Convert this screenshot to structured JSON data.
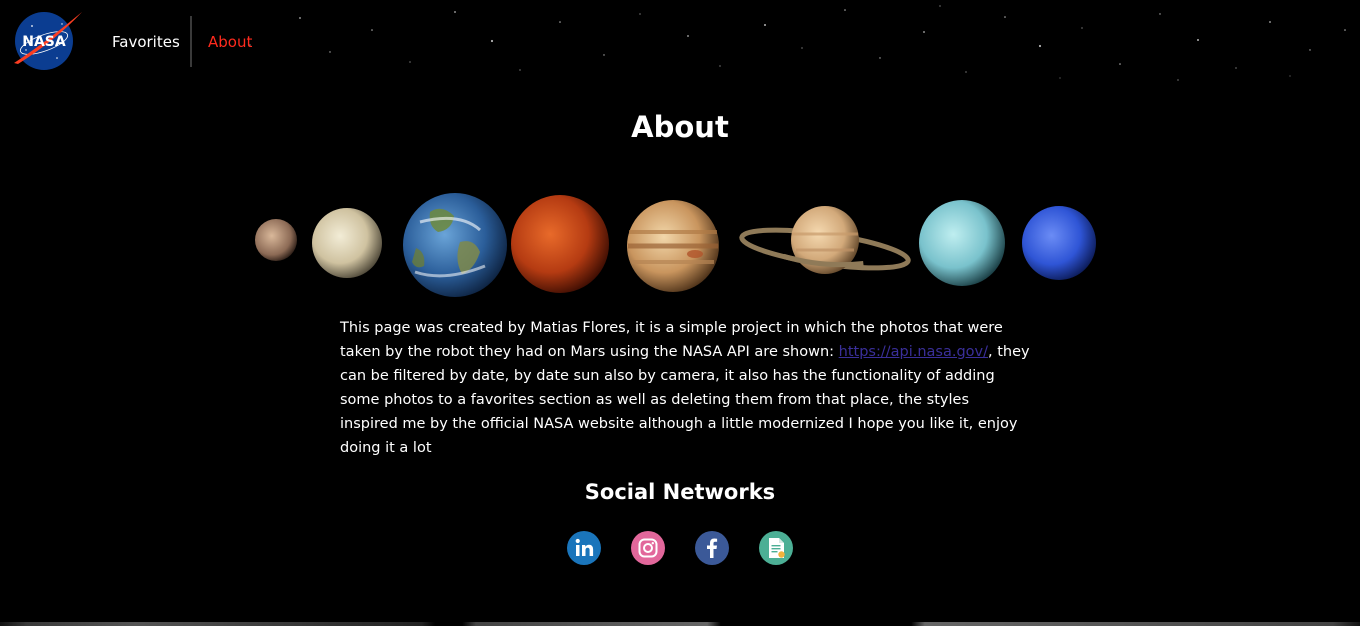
{
  "header": {
    "logo_text": "NASA",
    "nav": {
      "favorites": "Favorites",
      "about": "About"
    },
    "active_color": "#ff2a1d"
  },
  "main": {
    "title": "About",
    "planets": [
      "Mercury",
      "Venus",
      "Earth",
      "Mars",
      "Jupiter",
      "Saturn",
      "Uranus",
      "Neptune"
    ],
    "description": {
      "before_link": "This page was created by Matias Flores, it is a simple project in which the photos that were taken by the robot they had on Mars using the NASA API are shown: ",
      "link_text": "https://api.nasa.gov/",
      "after_link": ", they can be filtered by date, by date sun also by camera, it also has the functionality of adding some photos to a favorites section as well as deleting them from that place, the styles inspired me by the official NASA website although a little modernized I hope you like it, enjoy doing it a lot"
    },
    "social_title": "Social Networks",
    "social": [
      {
        "name": "linkedin-icon",
        "color": "#1a75bb"
      },
      {
        "name": "instagram-icon",
        "color": "#e2679b"
      },
      {
        "name": "facebook-icon",
        "color": "#3b5998"
      },
      {
        "name": "resume-document-icon",
        "color": "#4caf95"
      }
    ]
  }
}
